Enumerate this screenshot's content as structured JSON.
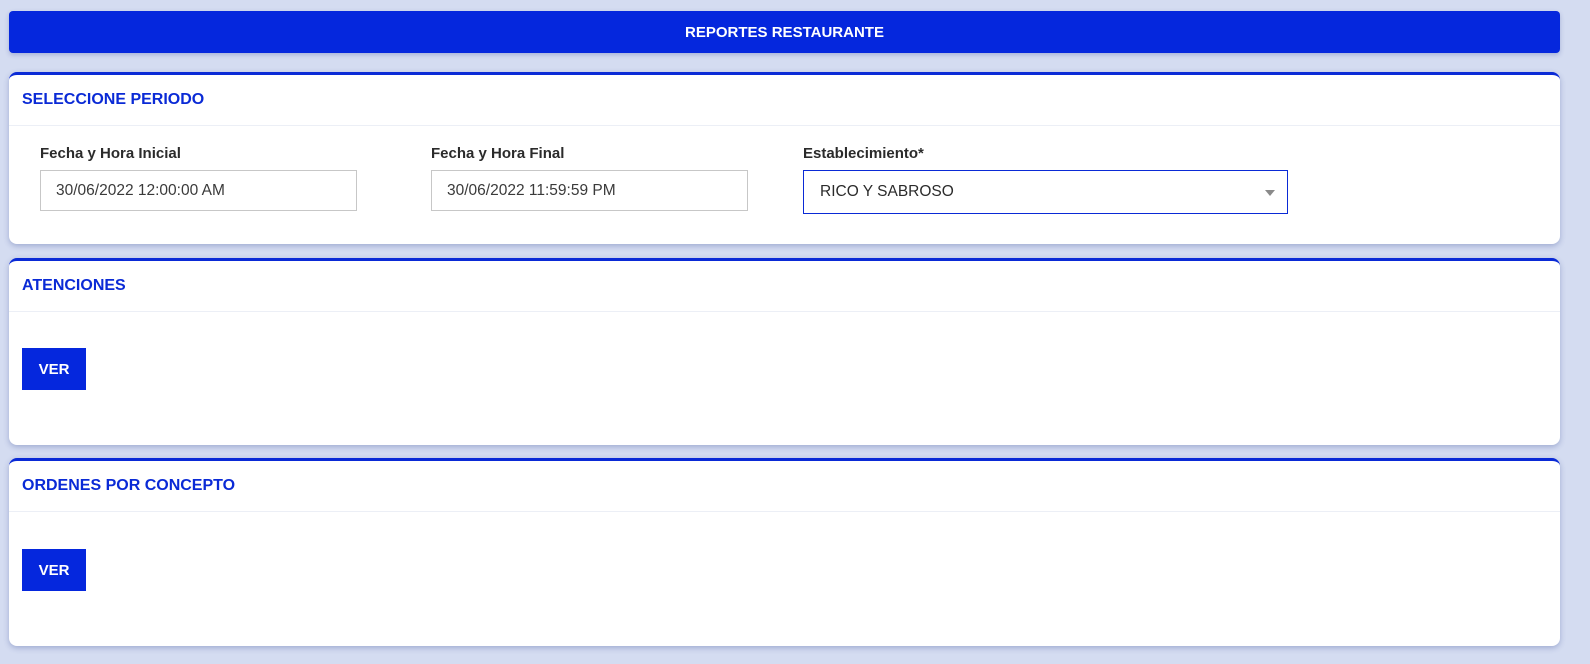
{
  "header": {
    "title": "REPORTES RESTAURANTE"
  },
  "periodo": {
    "title": "SELECCIONE PERIODO",
    "fecha_inicial": {
      "label": "Fecha y Hora Inicial",
      "value": "30/06/2022 12:00:00 AM"
    },
    "fecha_final": {
      "label": "Fecha y Hora Final",
      "value": "30/06/2022 11:59:59 PM"
    },
    "establecimiento": {
      "label": "Establecimiento*",
      "selected": "RICO Y SABROSO"
    }
  },
  "atenciones": {
    "title": "ATENCIONES",
    "button_label": "VER"
  },
  "ordenes": {
    "title": "ORDENES POR CONCEPTO",
    "button_label": "VER"
  },
  "colors": {
    "primary": "#0527dd",
    "background": "#d4dcf1"
  }
}
